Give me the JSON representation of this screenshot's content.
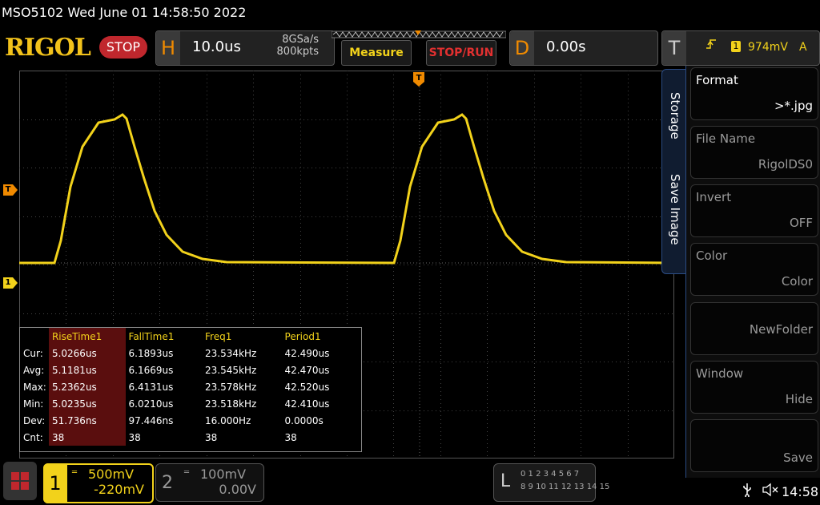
{
  "header": {
    "model_datetime": "MSO5102  Wed June 01 14:58:50 2022",
    "logo": "RIGOL",
    "run_state": "STOP",
    "horizontal": {
      "letter": "H",
      "timebase": "10.0us",
      "sample_rate": "8GSa/s",
      "memory_depth": "800kpts"
    },
    "measure_label": "Measure",
    "stoprun_label": "STOP/RUN",
    "delay": {
      "letter": "D",
      "value": "0.00s"
    },
    "trigger": {
      "letter": "T",
      "source": "1",
      "level": "974mV",
      "mode": "A"
    }
  },
  "markers": {
    "trigger_top": "T",
    "trigger_left": "T",
    "ch1_ground": "1"
  },
  "measurements": {
    "headers": [
      "RiseTime1",
      "FallTime1",
      "Freq1",
      "Period1"
    ],
    "rows": [
      {
        "label": "Cur:",
        "values": [
          "5.0266us",
          "6.1893us",
          "23.534kHz",
          "42.490us"
        ]
      },
      {
        "label": "Avg:",
        "values": [
          "5.1181us",
          "6.1669us",
          "23.545kHz",
          "42.470us"
        ]
      },
      {
        "label": "Max:",
        "values": [
          "5.2362us",
          "6.4131us",
          "23.578kHz",
          "42.520us"
        ]
      },
      {
        "label": "Min:",
        "values": [
          "5.0235us",
          "6.0210us",
          "23.518kHz",
          "42.410us"
        ]
      },
      {
        "label": "Dev:",
        "values": [
          "51.736ns",
          "97.446ns",
          "16.000Hz",
          "0.0000s"
        ]
      },
      {
        "label": "Cnt:",
        "values": [
          "38",
          "38",
          "38",
          "38"
        ]
      }
    ]
  },
  "sidetabs": {
    "storage": "Storage",
    "save_image": "Save Image"
  },
  "menu": {
    "items": [
      {
        "label": "Format",
        "value": ">*.jpg"
      },
      {
        "label": "File Name",
        "value": "RigolDS0"
      },
      {
        "label": "Invert",
        "value": "OFF"
      },
      {
        "label": "Color",
        "value": "Color"
      },
      {
        "label": "",
        "value": "NewFolder"
      },
      {
        "label": "Window",
        "value": "Hide"
      },
      {
        "label": "",
        "value": "Save"
      }
    ]
  },
  "channels": {
    "ch1": {
      "number": "1",
      "scale": "500mV",
      "offset": "-220mV"
    },
    "ch2": {
      "number": "2",
      "scale": "100mV",
      "offset": "0.00V"
    }
  },
  "logic": {
    "letter": "L",
    "row1": "0 1 2 3  4 5 6 7",
    "row2": "8 9 10 11 12 13 14 15"
  },
  "status": {
    "time": "14:58",
    "usb_icon": "usb-icon",
    "speaker_icon": "speaker-muted-icon"
  },
  "colors": {
    "ch1": "#f2d21b",
    "accent_orange": "#f08a00",
    "stop_red": "#c0272d",
    "menu_blue": "#2b4c84"
  }
}
